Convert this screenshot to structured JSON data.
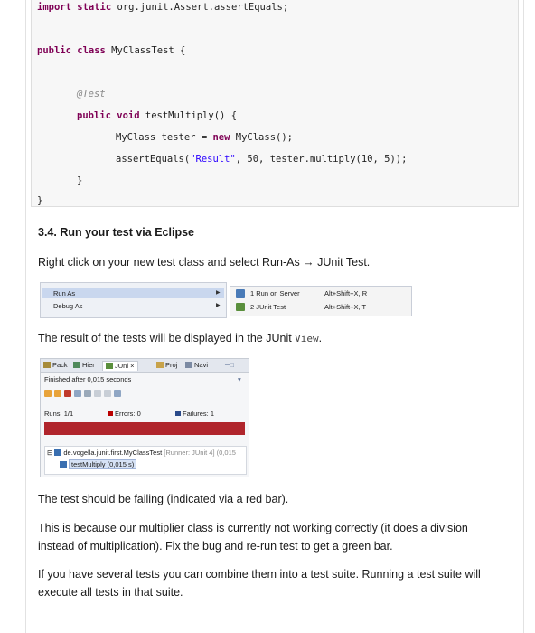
{
  "code": {
    "import_line": {
      "kw": "import static",
      "rest": " org.junit.Assert.assertEquals;"
    },
    "class_line": {
      "kw": "public class",
      "rest": " MyClassTest {"
    },
    "annotation": "@Test",
    "method_line": {
      "kw": "public void",
      "rest": " testMultiply() {"
    },
    "tester_line": {
      "pre": "MyClass tester = ",
      "kw": "new",
      "post": " MyClass();"
    },
    "assert_line": {
      "pre": "assertEquals(",
      "str": "\"Result\"",
      "post": ", 50, tester.multiply(10, 5));"
    },
    "close_method": "}",
    "close_class": "}"
  },
  "section_heading": "3.4. Run your test via Eclipse",
  "instruction": "Right click on your new test class and select Run-As → JUnit Test.",
  "menu": {
    "items": [
      "Run As",
      "Debug As"
    ],
    "submenu": [
      {
        "label": "1 Run on Server",
        "shortcut": "Alt+Shift+X, R"
      },
      {
        "label": "2 JUnit Test",
        "shortcut": "Alt+Shift+X, T"
      }
    ]
  },
  "result_text": {
    "pre": "The result of the tests will be displayed in the JUnit ",
    "code": "View",
    "post": "."
  },
  "junit_view": {
    "tabs": [
      "Pack",
      "Hier",
      "JUni",
      "Proj",
      "Navi"
    ],
    "finished": "Finished after 0,015 seconds",
    "runs_label": "Runs:",
    "runs_value": "1/1",
    "errors_label": "Errors:",
    "errors_value": "0",
    "failures_label": "Failures:",
    "failures_value": "1",
    "bar_color": "#b0252c",
    "tree_class": "de.vogella.junit.first.MyClassTest",
    "tree_runner": "[Runner: JUnit 4] (0,015",
    "tree_method": "testMultiply (0,015 s)"
  },
  "para_failing": "The test should be failing (indicated via a red bar).",
  "para_reason": "This is because our multiplier class is currently not working correctly (it does a division instead of multiplication). Fix the bug and re-run test to get a green bar.",
  "para_suite": "If you have several tests you can combine them into a test suite. Running a test suite will execute all tests in that suite."
}
